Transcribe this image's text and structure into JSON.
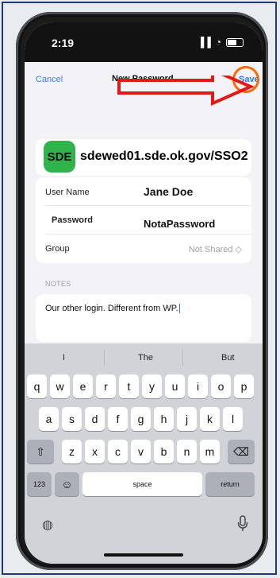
{
  "status_bar": {
    "time": "2:19",
    "signal": "▐▐",
    "wifi": "◔"
  },
  "nav": {
    "cancel": "Cancel",
    "title": "New Password",
    "save": "Save"
  },
  "site": {
    "badge": "SDE",
    "url": "sdewed01.sde.ok.gov/SSO2"
  },
  "fields": {
    "user_name_label": "User Name",
    "user_name_value": "Jane Doe",
    "password_label": "Password",
    "password_value": "NotaPassword",
    "group_label": "Group",
    "group_value": "Not Shared ◇"
  },
  "notes": {
    "label": "NOTES",
    "text": "Our other login. Different from WP."
  },
  "keyboard": {
    "suggestions": [
      "I",
      "The",
      "But"
    ],
    "row1": [
      "q",
      "w",
      "e",
      "r",
      "t",
      "y",
      "u",
      "i",
      "o",
      "p"
    ],
    "row2": [
      "a",
      "s",
      "d",
      "f",
      "g",
      "h",
      "j",
      "k",
      "l"
    ],
    "row3": [
      "z",
      "x",
      "c",
      "v",
      "b",
      "n",
      "m"
    ],
    "shift": "⇧",
    "backspace": "⌫",
    "numbers": "123",
    "emoji": "☺",
    "space": "space",
    "return": "return",
    "globe": "◍",
    "mic": "0"
  },
  "colors": {
    "accent": "#2f76e8",
    "annotation": "#e11919",
    "circle": "#ff6a00",
    "badge": "#2fb34a"
  }
}
